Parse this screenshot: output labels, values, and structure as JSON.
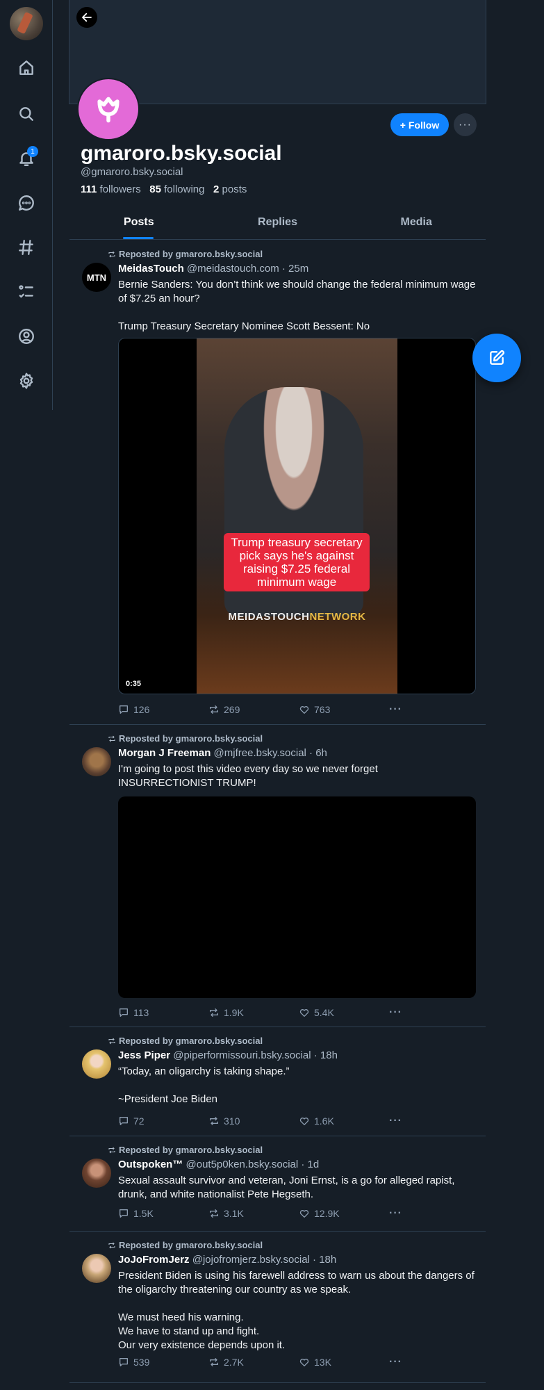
{
  "nav": {
    "notif_count": "1",
    "items": [
      "home-icon",
      "search-icon",
      "bell-icon",
      "chat-icon",
      "hashtag-icon",
      "list-icon",
      "profile-icon",
      "gear-icon"
    ]
  },
  "profile": {
    "display_name": "gmaroro.bsky.social",
    "handle": "@gmaroro.bsky.social",
    "followers_count": "111",
    "followers_label": "followers",
    "following_count": "85",
    "following_label": "following",
    "posts_count": "2",
    "posts_label": "posts",
    "follow_label": "Follow",
    "avatar_color": "#e36ad7"
  },
  "tabs": [
    {
      "label": "Posts",
      "active": true
    },
    {
      "label": "Replies",
      "active": false
    },
    {
      "label": "Media",
      "active": false
    }
  ],
  "posts": [
    {
      "repost_label": "Reposted by gmaroro.bsky.social",
      "author": "MeidasTouch",
      "meta": "@meidastouch.com · 25m",
      "text": "Bernie Sanders: You don’t think we should change the federal minimum wage of $7.25 an hour?\n\nTrump Treasury Secretary Nominee Scott Bessent: No",
      "avatar_text": "MTN",
      "video": {
        "caption": "Trump treasury secretary pick says he's against raising $7.25 federal minimum wage",
        "brand_a": "MEIDASTOUCH",
        "brand_b": "NETWORK",
        "duration": "0:35"
      },
      "replies": "126",
      "reposts": "269",
      "likes": "763"
    },
    {
      "repost_label": "Reposted by gmaroro.bsky.social",
      "author": "Morgan J Freeman",
      "meta": "@mjfree.bsky.social · 6h",
      "text": "I'm going to post this video every day so we never forget INSURRECTIONIST TRUMP!",
      "replies": "113",
      "reposts": "1.9K",
      "likes": "5.4K"
    },
    {
      "repost_label": "Reposted by gmaroro.bsky.social",
      "author": "Jess Piper",
      "meta": "@piperformissouri.bsky.social · 18h",
      "text": "“Today, an oligarchy is taking shape.”\n\n~President Joe Biden",
      "replies": "72",
      "reposts": "310",
      "likes": "1.6K"
    },
    {
      "repost_label": "Reposted by gmaroro.bsky.social",
      "author": "Outspoken™",
      "meta": "@out5p0ken.bsky.social · 1d",
      "text": "Sexual assault survivor and veteran, Joni Ernst, is a go for alleged rapist, drunk, and white nationalist Pete Hegseth.",
      "replies": "1.5K",
      "reposts": "3.1K",
      "likes": "12.9K"
    },
    {
      "repost_label": "Reposted by gmaroro.bsky.social",
      "author": "JoJoFromJerz",
      "meta": "@jojofromjerz.bsky.social · 18h",
      "text": "President Biden is using his farewell address to warn us about the dangers of the oligarchy threatening our country as we speak.\n\nWe must heed his warning.\nWe have to stand up and fight.\nOur very existence depends upon it.",
      "replies": "539",
      "reposts": "2.7K",
      "likes": "13K"
    }
  ],
  "colors": {
    "accent": "#1083fe",
    "background": "#161e27",
    "border": "#2e4052"
  }
}
